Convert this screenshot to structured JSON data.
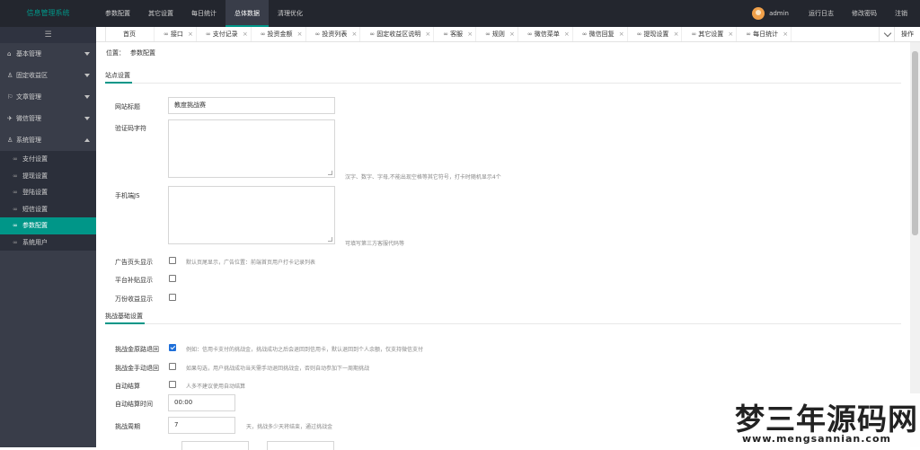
{
  "app": {
    "title": "信息管理系统"
  },
  "topnav": [
    {
      "label": "参数配置"
    },
    {
      "label": "其它设置"
    },
    {
      "label": "每日统计"
    },
    {
      "label": "总体数据",
      "active": true
    },
    {
      "label": "清理优化"
    }
  ],
  "topright": {
    "user": "admin",
    "log": "运行日志",
    "password": "修改密码",
    "logout": "注销"
  },
  "sidebar": {
    "toggle": "☰",
    "menus": [
      {
        "icon": "⌂",
        "label": "基本管理",
        "expanded": false
      },
      {
        "icon": "♙",
        "label": "固定收益区",
        "expanded": false
      },
      {
        "icon": "⚐",
        "label": "文章管理",
        "expanded": false
      },
      {
        "icon": "✈",
        "label": "微信管理",
        "expanded": false
      },
      {
        "icon": "♙",
        "label": "系统管理",
        "expanded": true
      }
    ],
    "submenus": [
      {
        "label": "支付设置"
      },
      {
        "label": "提现设置"
      },
      {
        "label": "登陆设置"
      },
      {
        "label": "短信设置"
      },
      {
        "label": "参数配置",
        "active": true
      },
      {
        "label": "系统用户"
      }
    ],
    "sub_icon": "∞"
  },
  "tabs": {
    "home": "首页",
    "close": "×",
    "tab_icon": "∞",
    "items": [
      {
        "label": "接口"
      },
      {
        "label": "支付记录"
      },
      {
        "label": "投资金额"
      },
      {
        "label": "投资列表"
      },
      {
        "label": "固定收益区说明"
      },
      {
        "label": "客服"
      },
      {
        "label": "规则"
      },
      {
        "label": "微信菜单"
      },
      {
        "label": "微信回复"
      },
      {
        "label": "提现设置"
      },
      {
        "label": "其它设置"
      },
      {
        "label": "每日统计"
      }
    ],
    "ops": "操作"
  },
  "breadcrumb": {
    "prefix": "位置：",
    "current": "参数配置"
  },
  "sections": {
    "site": "站点设置",
    "challenge": "挑战基础设置"
  },
  "form": {
    "site_title_label": "网站标题",
    "site_title_value": "教度挑战赛",
    "captcha_label": "验证码字符",
    "captcha_hint": "汉字、数字、字母,不能出现空格等其它符号，打卡时随机显示4个",
    "mobile_js_label": "手机端JS",
    "mobile_js_hint": "可填写第三方客服代码等",
    "ad_header_label": "广告页头显示",
    "ad_header_hint": "默认页尾显示，广告位置：前端首页用户打卡记录列表",
    "platform_subsidy_label": "平台补贴显示",
    "million_income_label": "万份收益显示",
    "auto_refund_label": "挑战金原路退回",
    "auto_refund_checked": true,
    "auto_refund_hint": "例如：信用卡支付的挑战金，挑战成功之后会退回到信用卡，默认退回到个人余额，仅支持微信支付",
    "manual_refund_label": "挑战金手动退回",
    "manual_refund_hint": "如果勾选，用户挑战成功当天需手动退回挑战金，否则自动参加下一周期挑战",
    "auto_settle_label": "自动结算",
    "auto_settle_hint": "人多不建议使用自动结算",
    "settle_time_label": "自动结算时间",
    "settle_time_value": "00:00",
    "period_label": "挑战周期",
    "period_value": "7",
    "period_hint": "天，挑战多少天将结束，通过挑战金"
  },
  "watermark": {
    "cn": "梦三年源码网",
    "url": "www.mengsannian.com"
  },
  "colors": {
    "accent": "#009688",
    "topbar": "#23262e",
    "sidebar": "#393d49"
  }
}
